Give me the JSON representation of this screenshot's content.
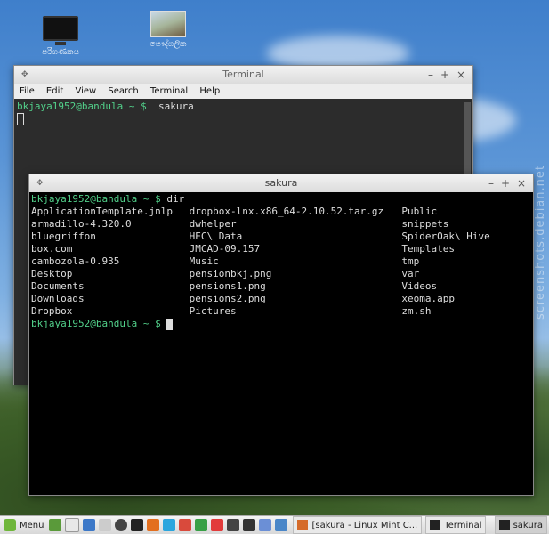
{
  "desktop": {
    "icons": [
      {
        "label": "පරිගණකය"
      },
      {
        "label": "පෞද්ගලික"
      }
    ],
    "watermark": "screenshots.debian.net"
  },
  "terminal_window": {
    "title": "Terminal",
    "menu": [
      "File",
      "Edit",
      "View",
      "Search",
      "Terminal",
      "Help"
    ],
    "prompt": "bkjaya1952@bandula ~ $",
    "command": "sakura"
  },
  "sakura_window": {
    "title": "sakura",
    "prompt": "bkjaya1952@bandula ~ $",
    "command": "dir",
    "listing": {
      "col1": [
        "ApplicationTemplate.jnlp",
        "armadillo-4.320.0",
        "bluegriffon",
        "box.com",
        "cambozola-0.935",
        "Desktop",
        "Documents",
        "Downloads",
        "Dropbox"
      ],
      "col2": [
        "dropbox-lnx.x86_64-2.10.52.tar.gz",
        "dwhelper",
        "HEC\\ Data",
        "JMCAD-09.157",
        "Music",
        "pensionbkj.png",
        "pensions1.png",
        "pensions2.png",
        "Pictures"
      ],
      "col3": [
        "Public",
        "snippets",
        "SpiderOak\\ Hive",
        "Templates",
        "tmp",
        "var",
        "Videos",
        "xeoma.app",
        "zm.sh"
      ]
    }
  },
  "taskbar": {
    "menu_label": "Menu",
    "tasks": [
      {
        "label": "[sakura - Linux Mint C..."
      },
      {
        "label": "Terminal"
      },
      {
        "label": "sakura"
      }
    ]
  },
  "colors": {
    "prompt_green": "#52d08a",
    "mint_green": "#6fb63a"
  }
}
